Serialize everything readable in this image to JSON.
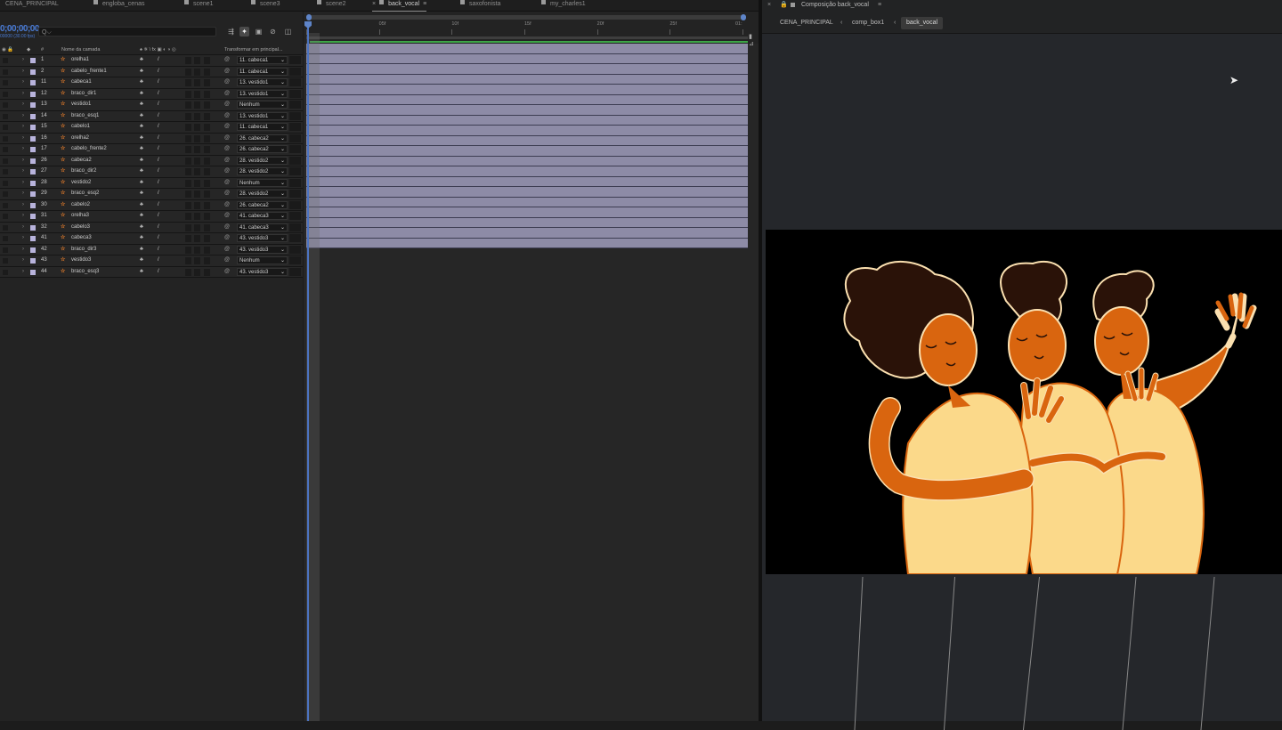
{
  "tabs": [
    {
      "label": "CENA_PRINCIPAL",
      "active": false
    },
    {
      "label": "engloba_cenas",
      "active": false
    },
    {
      "label": "scene1",
      "active": false
    },
    {
      "label": "scene3",
      "active": false
    },
    {
      "label": "scene2",
      "active": false
    },
    {
      "label": "back_vocal",
      "active": true
    },
    {
      "label": "saxofonista",
      "active": false
    },
    {
      "label": "my_charles1",
      "active": false
    }
  ],
  "timeline": {
    "timecode": "0;00;00;00",
    "timecode_sub": "00000 (30.00 fps)",
    "search_placeholder": "Q⌵",
    "columns": {
      "number": "#",
      "layer_name": "Nome da camada",
      "switches": "♠ ✵ \\ fx ▣ ◐ ◑ ◎",
      "parent": "Transformar em principal..."
    },
    "ruler_labels": [
      "0f",
      "05f",
      "10f",
      "15f",
      "20f",
      "25f",
      "01:"
    ],
    "layers": [
      {
        "number": "1",
        "name": "orelha1",
        "parent": "11. cabeca1"
      },
      {
        "number": "2",
        "name": "cabelo_frente1",
        "parent": "11. cabeca1"
      },
      {
        "number": "11",
        "name": "cabeca1",
        "parent": "13. vestido1"
      },
      {
        "number": "12",
        "name": "braco_dir1",
        "parent": "13. vestido1"
      },
      {
        "number": "13",
        "name": "vestido1",
        "parent": "Nenhum"
      },
      {
        "number": "14",
        "name": "braco_esq1",
        "parent": "13. vestido1"
      },
      {
        "number": "15",
        "name": "cabelo1",
        "parent": "11. cabeca1"
      },
      {
        "number": "16",
        "name": "orelha2",
        "parent": "26. cabeca2"
      },
      {
        "number": "17",
        "name": "cabelo_frente2",
        "parent": "26. cabeca2"
      },
      {
        "number": "26",
        "name": "cabeca2",
        "parent": "28. vestido2"
      },
      {
        "number": "27",
        "name": "braco_dir2",
        "parent": "28. vestido2"
      },
      {
        "number": "28",
        "name": "vestido2",
        "parent": "Nenhum"
      },
      {
        "number": "29",
        "name": "braco_esq2",
        "parent": "28. vestido2"
      },
      {
        "number": "30",
        "name": "cabelo2",
        "parent": "26. cabeca2"
      },
      {
        "number": "31",
        "name": "orelha3",
        "parent": "41. cabeca3"
      },
      {
        "number": "32",
        "name": "cabelo3",
        "parent": "41. cabeca3"
      },
      {
        "number": "41",
        "name": "cabeca3",
        "parent": "43. vestido3"
      },
      {
        "number": "42",
        "name": "braco_dir3",
        "parent": "43. vestido3"
      },
      {
        "number": "43",
        "name": "vestido3",
        "parent": "Nenhum"
      },
      {
        "number": "44",
        "name": "braco_esq3",
        "parent": "43. vestido3"
      }
    ]
  },
  "composition": {
    "panel_title": "Composição back_vocal",
    "breadcrumbs": [
      "CENA_PRINCIPAL",
      "comp_box1",
      "back_vocal"
    ]
  },
  "colors": {
    "layer_label": "#b8b3dc",
    "layer_bar": "#8d8ba6",
    "skin": "#d9650f",
    "dress": "#fbd98a",
    "hair": "#2a1208",
    "outline": "#fbe0b0",
    "timecode": "#4a7bd4"
  }
}
